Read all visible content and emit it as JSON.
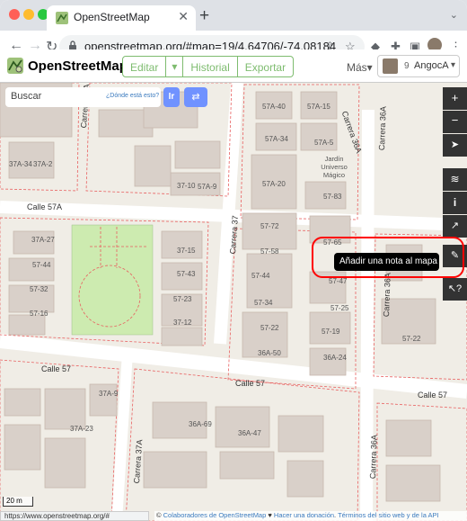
{
  "browser": {
    "tab_title": "OpenStreetMap",
    "url": "openstreetmap.org/#map=19/4.64706/-74.08184",
    "status_url": "https://www.openstreetmap.org/#"
  },
  "osm": {
    "brand": "OpenStreetMap",
    "edit": "Editar",
    "history": "Historial",
    "export": "Exportar",
    "more": "Más",
    "user_count": "9",
    "username": "AngocA"
  },
  "search": {
    "placeholder": "Buscar",
    "where": "¿Dónde está esto?",
    "go": "Ir"
  },
  "controls": {
    "tooltip": "Añadir una nota al mapa"
  },
  "map": {
    "streets": [
      "Calle 57A",
      "Calle 57",
      "Calle 57",
      "Carrera 37A",
      "Carrera 37",
      "Carrera 36A",
      "Carrera 36A",
      "Carrera 37A",
      "Carrera 36A",
      "Carrera 36A"
    ],
    "poi": "Jardín Universo Mágico",
    "scale": "20 m",
    "attribution_prefix": "© ",
    "attribution_link1": "Colaboradores de OpenStreetMap",
    "attribution_heart": " ♥ ",
    "attribution_link2": "Hacer una donación",
    "attribution_sep": ". ",
    "attribution_link3": "Términos del sitio web y de la API"
  },
  "house_numbers": [
    "37A-34",
    "37A-2",
    "37-10",
    "57A-9",
    "57A-40",
    "57A-15",
    "57A-34",
    "57A-5",
    "57A-20",
    "57-83",
    "57-72",
    "57-58",
    "57-65",
    "57-44",
    "57-34",
    "57-22",
    "36A-50",
    "57-47",
    "57-25",
    "57-19",
    "36A-24",
    "37A-27",
    "57-44",
    "57-32",
    "57-16",
    "37-15",
    "57-43",
    "57-23",
    "37-12",
    "57-22",
    "37A-9",
    "37A-23",
    "36A-69",
    "36A-47"
  ]
}
